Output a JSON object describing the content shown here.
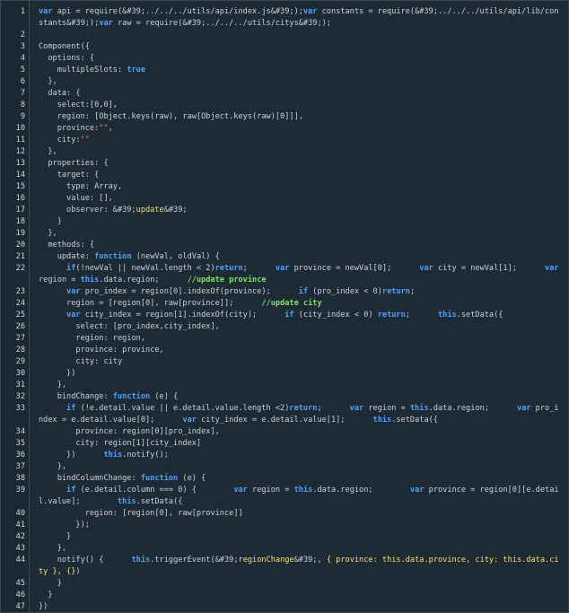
{
  "editor": {
    "lines": [
      {
        "n": "1",
        "html": "<span class=\"k\">var</span> api = require(&amp;#39;../../../utils/api/index.js&amp;#39;);<span class=\"k\">var</span> constants = require(&amp;#39;../../../utils/api/lib/constants&amp;#39;);<span class=\"k\">var</span> raw = require(&amp;#39;../../../utils/citys&amp;#39;);"
      },
      {
        "n": "2",
        "html": ""
      },
      {
        "n": "3",
        "html": "Component({"
      },
      {
        "n": "4",
        "html": "  options: {"
      },
      {
        "n": "5",
        "html": "    multipleSlots: <span class=\"k\">true</span>"
      },
      {
        "n": "6",
        "html": "  },"
      },
      {
        "n": "7",
        "html": "  data: {"
      },
      {
        "n": "8",
        "html": "    select:[0,0],"
      },
      {
        "n": "9",
        "html": "    region: [Object.keys(raw), raw[Object.keys(raw)[0]]],"
      },
      {
        "n": "10",
        "html": "    province:<span class=\"s\">\"\"</span>,"
      },
      {
        "n": "11",
        "html": "    city:<span class=\"s\">\"\"</span>"
      },
      {
        "n": "12",
        "html": "  },"
      },
      {
        "n": "13",
        "html": "  properties: {"
      },
      {
        "n": "14",
        "html": "    target: {"
      },
      {
        "n": "15",
        "html": "      type: Array,"
      },
      {
        "n": "16",
        "html": "      value: [],"
      },
      {
        "n": "17",
        "html": "      observer: &amp;#39;<span class=\"y\">update</span>&amp;#39;"
      },
      {
        "n": "18",
        "html": "    }"
      },
      {
        "n": "19",
        "html": "  },"
      },
      {
        "n": "20",
        "html": "  methods: {"
      },
      {
        "n": "21",
        "html": "    update: <span class=\"k\">function</span> (newVal, oldVal) {"
      },
      {
        "n": "22",
        "html": "      <span class=\"k\">if</span>(!newVal || newVal.length &lt; 2)<span class=\"k\">return</span>;      <span class=\"k\">var</span> province = newVal[0];      <span class=\"k\">var</span> city = newVal[1];      <span class=\"k\">var</span> region = <span class=\"k\">this</span>.data.region;      <span class=\"c\">//update province</span>"
      },
      {
        "n": "23",
        "html": "      <span class=\"k\">var</span> pro_index = region[0].indexOf(province);      <span class=\"k\">if</span> (pro_index &lt; 0)<span class=\"k\">return</span>;"
      },
      {
        "n": "24",
        "html": "      region = [region[0], raw[province]];      <span class=\"c\">//update city</span>"
      },
      {
        "n": "25",
        "html": "      <span class=\"k\">var</span> city_index = region[1].indexOf(city);      <span class=\"k\">if</span> (city_index &lt; 0) <span class=\"k\">return</span>;      <span class=\"k\">this</span>.setData({"
      },
      {
        "n": "26",
        "html": "        select: [pro_index,city_index],"
      },
      {
        "n": "27",
        "html": "        region: region,"
      },
      {
        "n": "28",
        "html": "        province: province,"
      },
      {
        "n": "29",
        "html": "        city: city"
      },
      {
        "n": "30",
        "html": "      })"
      },
      {
        "n": "31",
        "html": "    },"
      },
      {
        "n": "32",
        "html": "    bindChange: <span class=\"k\">function</span> (e) {"
      },
      {
        "n": "33",
        "html": "      <span class=\"k\">if</span> (!e.detail.value || e.detail.value.length &lt;2)<span class=\"k\">return</span>;      <span class=\"k\">var</span> region = <span class=\"k\">this</span>.data.region;      <span class=\"k\">var</span> pro_index = e.detail.value[0];      <span class=\"k\">var</span> city_index = e.detail.value[1];      <span class=\"k\">this</span>.setData({"
      },
      {
        "n": "34",
        "html": "        province: region[0][pro_index],"
      },
      {
        "n": "35",
        "html": "        city: region[1][city_index]"
      },
      {
        "n": "36",
        "html": "      })      <span class=\"k\">this</span>.notify();"
      },
      {
        "n": "37",
        "html": "    },"
      },
      {
        "n": "38",
        "html": "    bindColumnChange: <span class=\"k\">function</span> (e) {"
      },
      {
        "n": "39",
        "html": "      <span class=\"k\">if</span> (e.detail.column === 0) {        <span class=\"k\">var</span> region = <span class=\"k\">this</span>.data.region;        <span class=\"k\">var</span> province = region[0][e.detail.value];        <span class=\"k\">this</span>.setData({"
      },
      {
        "n": "40",
        "html": "          region: [region[0], raw[province]]"
      },
      {
        "n": "41",
        "html": "        });"
      },
      {
        "n": "42",
        "html": "      }"
      },
      {
        "n": "43",
        "html": "    },"
      },
      {
        "n": "44",
        "html": "    notify() {      <span class=\"k\">this</span>.triggerEvent(&amp;#39;<span class=\"y\">regionChange</span>&amp;#39;, <span class=\"y\">{ province: this.data.province, city: this.data.city }, {}</span>)"
      },
      {
        "n": "45",
        "html": "    }"
      },
      {
        "n": "46",
        "html": "  }"
      },
      {
        "n": "47",
        "html": "})"
      }
    ]
  }
}
